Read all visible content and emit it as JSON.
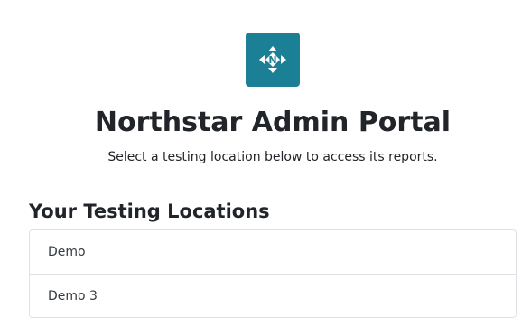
{
  "header": {
    "logo_icon": "compass-n-icon",
    "logo_letter": "N",
    "brand_color": "#1b7f95",
    "title": "Northstar Admin Portal",
    "subtitle": "Select a testing location below to access its reports."
  },
  "locations": {
    "heading": "Your Testing Locations",
    "items": [
      {
        "label": "Demo"
      },
      {
        "label": "Demo 3"
      }
    ]
  }
}
